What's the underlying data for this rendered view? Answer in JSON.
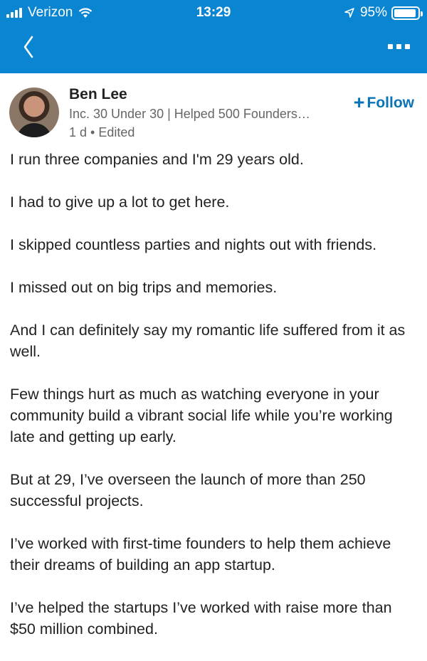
{
  "status_bar": {
    "carrier": "Verizon",
    "time": "13:29",
    "battery_percent": "95%",
    "battery_level": 0.95
  },
  "nav": {
    "back_icon": "chevron-left-icon",
    "more_icon": "more-horizontal-icon"
  },
  "post": {
    "author": {
      "name": "Ben Lee",
      "headline": "Inc. 30 Under 30 | Helped 500 Founders…",
      "meta": "1 d • Edited"
    },
    "follow_label": "Follow",
    "paragraphs": [
      "I run three companies and I'm 29 years old.",
      "I had to give up a lot to get here.",
      "I skipped countless parties and nights out with friends.",
      "I missed out on big trips and memories.",
      "And I can definitely say my romantic life suffered from it as well.",
      "Few things hurt as much as watching everyone in your community build a vibrant social life while you’re working late and getting up early.",
      "But at 29, I’ve overseen the launch of more than 250 successful projects.",
      "I’ve worked with first-time founders to help them achieve their dreams of building an app startup.",
      "I’ve helped the startups I’ve worked with raise more than $50 million combined."
    ]
  },
  "colors": {
    "header": "#0a85d1",
    "accent": "#0a73b7"
  }
}
